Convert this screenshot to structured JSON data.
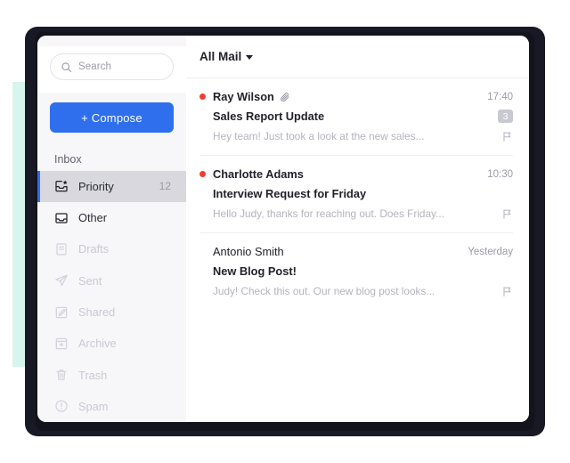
{
  "sidebar": {
    "search": {
      "placeholder": "Search",
      "icon": "search-icon"
    },
    "compose": {
      "label": "+ Compose"
    },
    "section_label": "Inbox",
    "items": [
      {
        "label": "Priority",
        "count": "12",
        "icon": "inbox-star-icon",
        "active": true,
        "muted": false
      },
      {
        "label": "Other",
        "count": "",
        "icon": "inbox-icon",
        "active": false,
        "muted": false
      },
      {
        "label": "Drafts",
        "count": "",
        "icon": "document-icon",
        "active": false,
        "muted": true
      },
      {
        "label": "Sent",
        "count": "",
        "icon": "paper-plane-icon",
        "active": false,
        "muted": true
      },
      {
        "label": "Shared",
        "count": "",
        "icon": "edit-square-icon",
        "active": false,
        "muted": true
      },
      {
        "label": "Archive",
        "count": "",
        "icon": "archive-icon",
        "active": false,
        "muted": true
      },
      {
        "label": "Trash",
        "count": "",
        "icon": "trash-icon",
        "active": false,
        "muted": true
      },
      {
        "label": "Spam",
        "count": "",
        "icon": "alert-circle-icon",
        "active": false,
        "muted": true
      }
    ]
  },
  "maillist": {
    "filter_label": "All Mail",
    "emails": [
      {
        "sender": "Ray Wilson",
        "subject": "Sales Report Update",
        "preview": "Hey team! Just took a look at the new sales...",
        "time": "17:40",
        "badge": "3",
        "unread": true,
        "attachment": true
      },
      {
        "sender": "Charlotte Adams",
        "subject": "Interview Request for Friday",
        "preview": "Hello Judy, thanks for reaching out. Does Friday...",
        "time": "10:30",
        "badge": "",
        "unread": true,
        "attachment": false
      },
      {
        "sender": "Antonio Smith",
        "subject": "New Blog Post!",
        "preview": "Judy! Check this out. Our new blog post looks...",
        "time": "Yesterday",
        "badge": "",
        "unread": false,
        "attachment": false
      }
    ]
  },
  "colors": {
    "accent_blue": "#2f6fed",
    "unread_red": "#f03e2f",
    "mint": "#d6f5ec",
    "frame_dark": "#191926",
    "sidebar_bg": "#f7f7fa"
  }
}
